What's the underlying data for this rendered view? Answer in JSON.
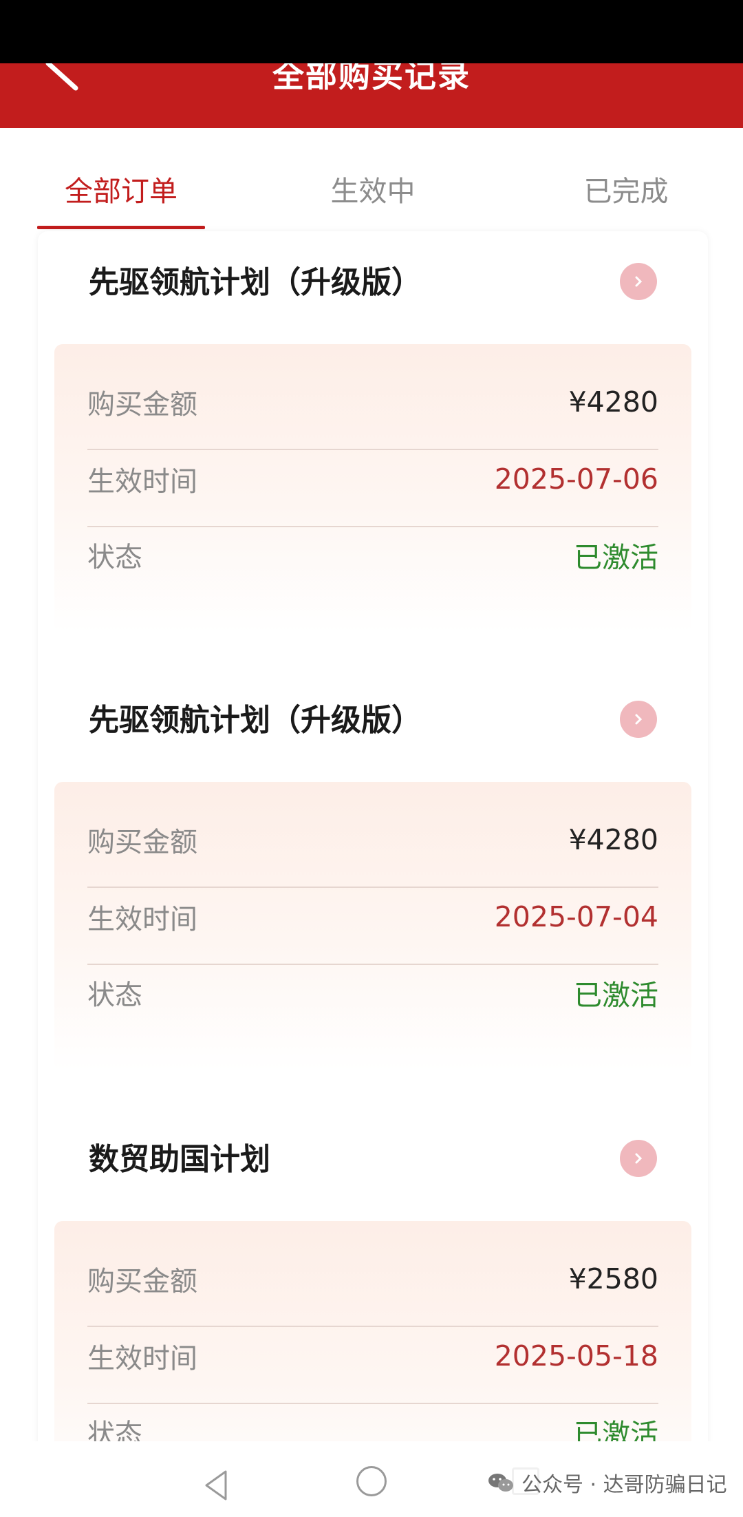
{
  "header": {
    "title": "全部购买记录"
  },
  "tabs": [
    {
      "label": "全部订单"
    },
    {
      "label": "生效中"
    },
    {
      "label": "已完成"
    }
  ],
  "orders": [
    {
      "title": "先驱领航计划（升级版）",
      "rows": [
        {
          "label": "购买金额",
          "value": "¥4280"
        },
        {
          "label": "生效时间",
          "value": "2025-07-06"
        },
        {
          "label": "状态",
          "value": "已激活"
        }
      ]
    },
    {
      "title": "先驱领航计划（升级版）",
      "rows": [
        {
          "label": "购买金额",
          "value": "¥4280"
        },
        {
          "label": "生效时间",
          "value": "2025-07-04"
        },
        {
          "label": "状态",
          "value": "已激活"
        }
      ]
    },
    {
      "title": "数贸助国计划",
      "rows": [
        {
          "label": "购买金额",
          "value": "¥2580"
        },
        {
          "label": "生效时间",
          "value": "2025-05-18"
        },
        {
          "label": "状态",
          "value": "已激活"
        }
      ]
    }
  ],
  "watermark": {
    "text": "公众号 · 达哥防骗日记"
  },
  "colors": {
    "brand_red": "#c21d1d",
    "date_red": "#b23030",
    "status_green": "#2e8b2e",
    "chevron_pink": "#f0b8bd"
  }
}
